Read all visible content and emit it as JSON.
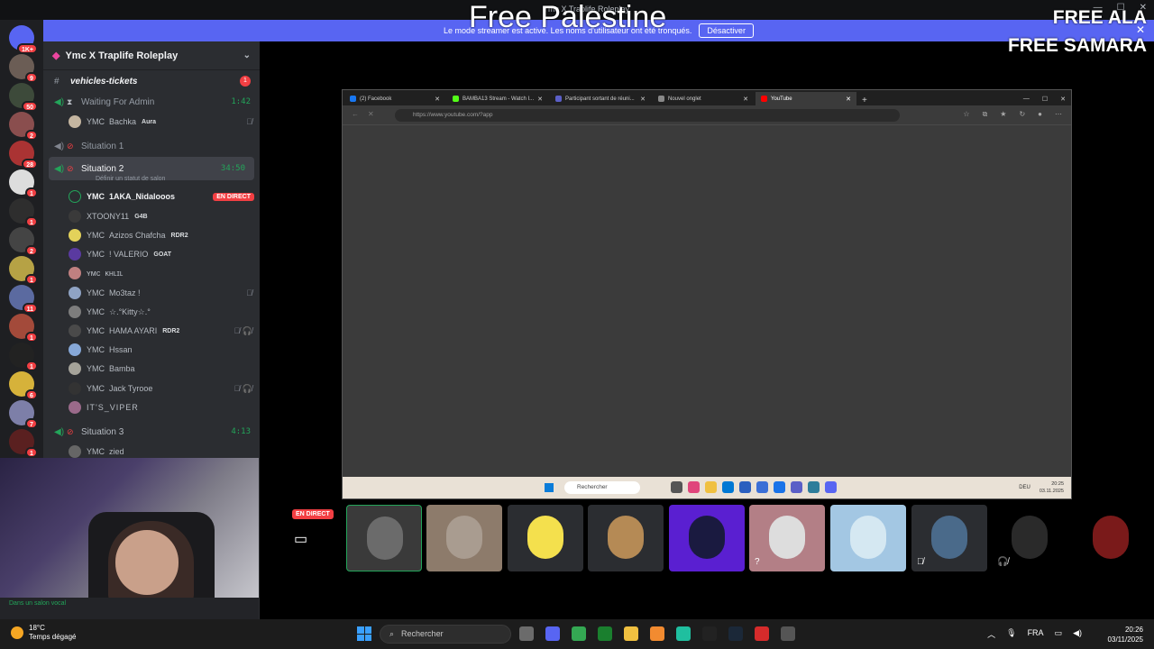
{
  "window": {
    "title": "Ymc X Traplife Roleplay"
  },
  "overlay": {
    "center_text": "Free Palestine",
    "right_line1": "FREE ALA",
    "right_line2": "FREE SAMARA"
  },
  "banner": {
    "message": "Le mode streamer est activé. Les noms d'utilisateur ont été tronqués.",
    "button": "Désactiver"
  },
  "server_rail": {
    "home_badge": "1K+",
    "badges": [
      "9",
      "50",
      "2",
      "28",
      "1",
      "1",
      "2",
      "1",
      "11",
      "1",
      "1",
      "6",
      "7",
      "1"
    ]
  },
  "server": {
    "name": "Ymc X Traplife Roleplay"
  },
  "channels": {
    "vehicles": {
      "name": "vehicles-tickets",
      "badge": "1"
    },
    "waiting": {
      "name": "Waiting For Admin",
      "timer": "1:42"
    },
    "situation1": {
      "name": "Situation 1"
    },
    "situation2": {
      "name": "Situation 2",
      "timer": "34:50",
      "status": "Définir un statut de salon"
    },
    "situation3": {
      "name": "Situation 3",
      "timer": "4:13"
    }
  },
  "members": {
    "bachka": {
      "prefix": "YMC",
      "name": "Bachka",
      "tag": "Aura"
    },
    "nidalooos": {
      "prefix": "YMC",
      "name": "1AKA_Nidalooos",
      "live": "EN DIRECT"
    },
    "xtoony": {
      "name": "XTOONY11",
      "tag": "G4B"
    },
    "azizos": {
      "prefix": "YMC",
      "name": "Azizos Chafcha",
      "tag": "RDR2"
    },
    "valerio": {
      "prefix": "YMC",
      "name": "! VALERIO",
      "tag": "GOAT"
    },
    "khlil": {
      "prefix": "ʏᴍᴄ",
      "name": "ᴋʜʟɪʟ"
    },
    "mo3taz": {
      "prefix": "YMC",
      "name": "Mo3taz !"
    },
    "kitty": {
      "prefix": "YMC",
      "name": "☆.°Kitty☆.°"
    },
    "hama": {
      "prefix": "YMC",
      "name": "HAMA AYARI",
      "tag": "RDR2"
    },
    "hssan": {
      "prefix": "YMC",
      "name": "Hssan"
    },
    "bamba": {
      "prefix": "YMC",
      "name": "Bamba"
    },
    "jack": {
      "prefix": "YMC",
      "name": "Jack Tyrooe"
    },
    "viper": {
      "name": "IT'S_VIPER"
    },
    "zied": {
      "prefix": "YMC",
      "name": "zied"
    }
  },
  "voice_status": "Dans un salon vocal",
  "browser": {
    "tabs": [
      "(2) Facebook",
      "BAMBA13 Stream - Watch I...",
      "Participant sortant de réuni...",
      "Nouvel onglet",
      "YouTube"
    ],
    "url": "https://www.youtube.com/?app",
    "taskbar_search": "Rechercher",
    "lang": "DEU",
    "time": "20:25",
    "date": "03.11.2025"
  },
  "stage": {
    "live_badge": "EN DIRECT"
  },
  "taskbar": {
    "temperature": "18°C",
    "weather": "Temps dégagé",
    "search": "Rechercher",
    "lang": "FRA",
    "time": "20:26",
    "date": "03/11/2025"
  }
}
